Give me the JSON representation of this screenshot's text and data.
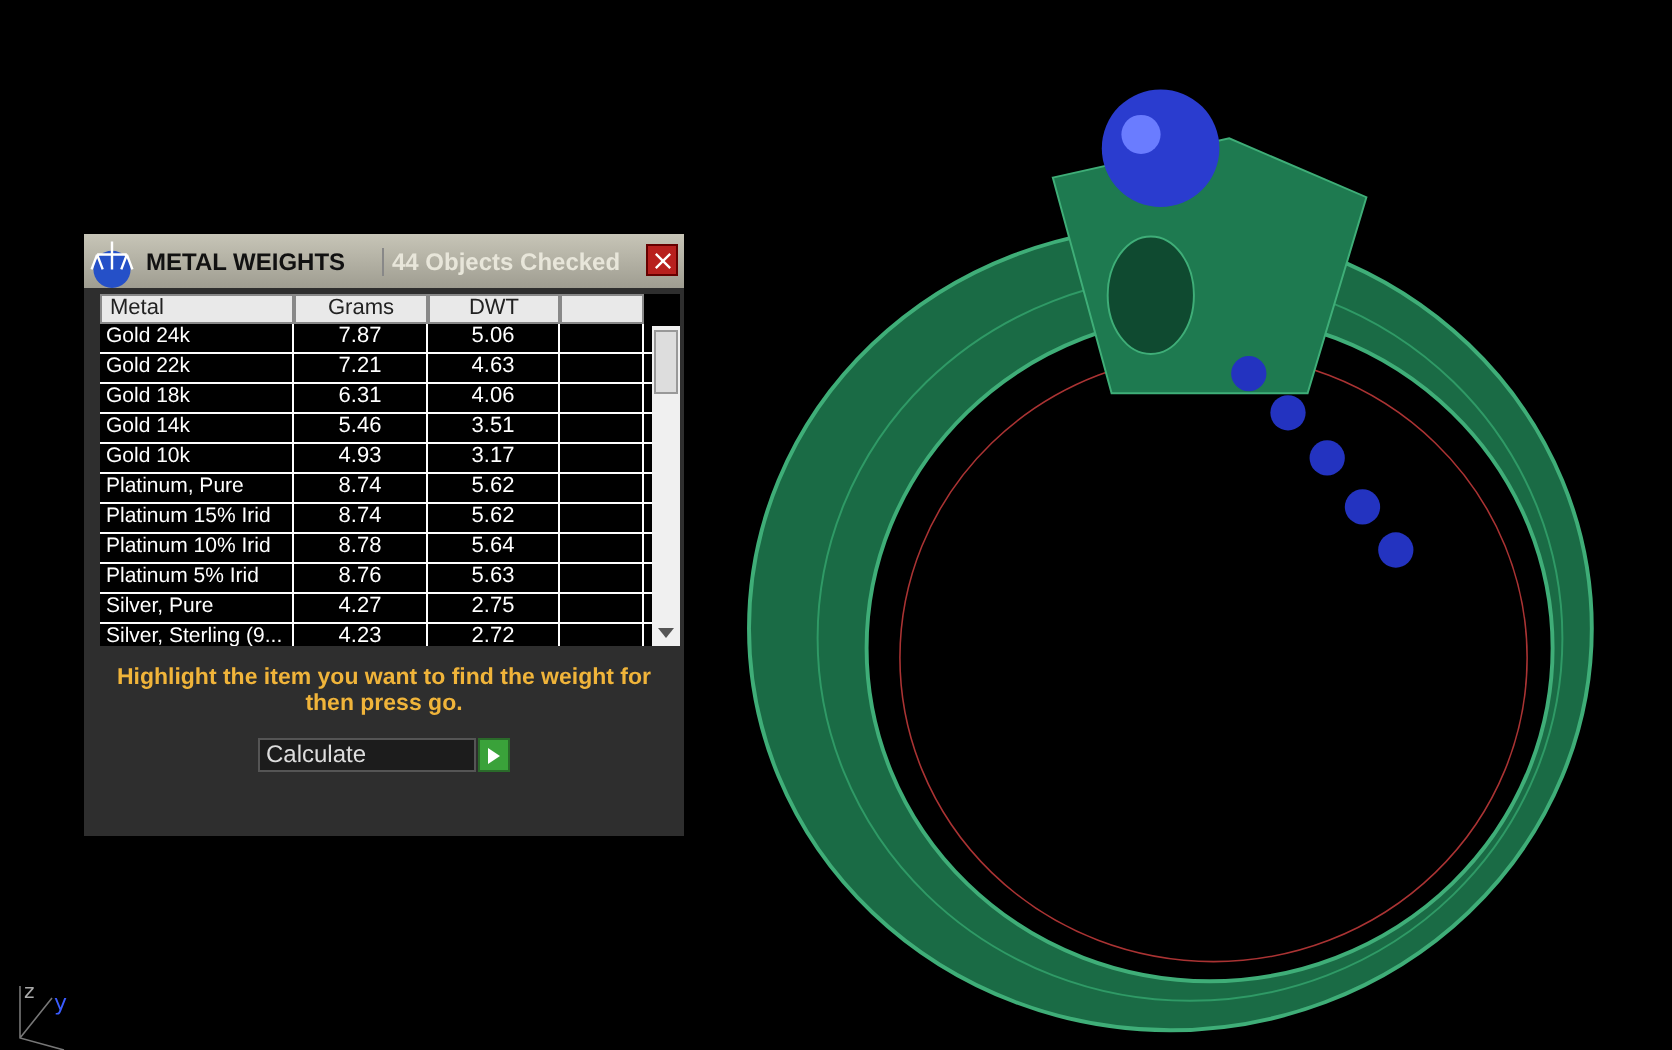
{
  "panel": {
    "title": "METAL WEIGHTS",
    "status": "44 Objects Checked"
  },
  "table": {
    "columns": [
      "Metal",
      "Grams",
      "DWT"
    ],
    "rows": [
      {
        "metal": "Gold 24k",
        "grams": "7.87",
        "dwt": "5.06"
      },
      {
        "metal": "Gold 22k",
        "grams": "7.21",
        "dwt": "4.63"
      },
      {
        "metal": "Gold 18k",
        "grams": "6.31",
        "dwt": "4.06"
      },
      {
        "metal": "Gold 14k",
        "grams": "5.46",
        "dwt": "3.51"
      },
      {
        "metal": "Gold 10k",
        "grams": "4.93",
        "dwt": "3.17"
      },
      {
        "metal": "Platinum, Pure",
        "grams": "8.74",
        "dwt": "5.62"
      },
      {
        "metal": "Platinum 15% Irid",
        "grams": "8.74",
        "dwt": "5.62"
      },
      {
        "metal": "Platinum 10% Irid",
        "grams": "8.78",
        "dwt": "5.64"
      },
      {
        "metal": "Platinum 5% Irid",
        "grams": "8.76",
        "dwt": "5.63"
      },
      {
        "metal": "Silver, Pure",
        "grams": "4.27",
        "dwt": "2.75"
      },
      {
        "metal": "Silver, Sterling (9...",
        "grams": "4.23",
        "dwt": "2.72"
      }
    ]
  },
  "instruction": "Highlight the item you want to find the weight for then press go.",
  "action": {
    "value": "Calculate"
  },
  "axes": {
    "z": "z",
    "y": "y"
  }
}
